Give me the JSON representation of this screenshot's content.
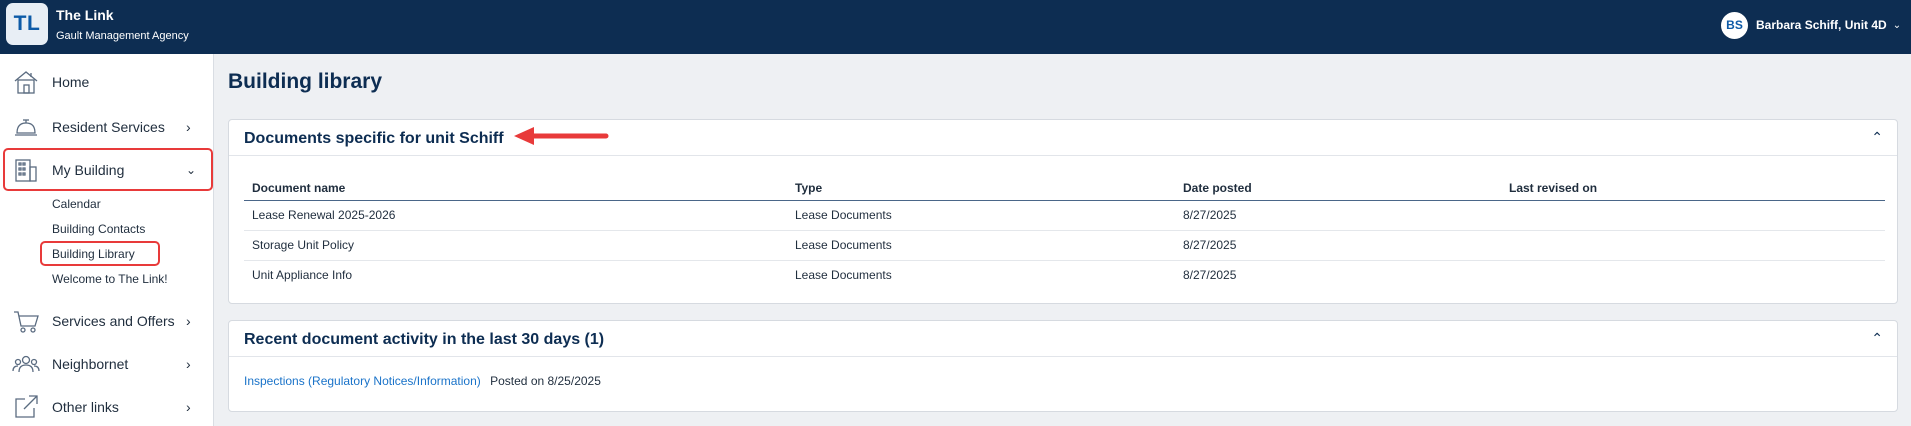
{
  "header": {
    "logo_text": "TL",
    "app_name": "The Link",
    "agency": "Gault Management Agency",
    "user_initials": "BS",
    "user_name": "Barbara Schiff, Unit 4D"
  },
  "sidebar": {
    "items": [
      {
        "label": "Home",
        "icon": "house-icon"
      },
      {
        "label": "Resident Services",
        "icon": "service-bell-icon"
      },
      {
        "label": "My Building",
        "icon": "building-icon"
      },
      {
        "label": "Services and Offers",
        "icon": "shopping-cart-icon"
      },
      {
        "label": "Neighbornet",
        "icon": "people-icon"
      },
      {
        "label": "Other links",
        "icon": "external-link-icon"
      }
    ],
    "sub_items": [
      "Calendar",
      "Building Contacts",
      "Building Library",
      "Welcome to The Link!"
    ]
  },
  "main": {
    "page_title": "Building library",
    "documents_card": {
      "title": "Documents specific for unit Schiff",
      "columns": [
        "Document name",
        "Type",
        "Date posted",
        "Last revised on"
      ],
      "rows": [
        {
          "name": "Lease Renewal 2025-2026",
          "type": "Lease Documents",
          "posted": "8/27/2025",
          "revised": ""
        },
        {
          "name": "Storage Unit Policy",
          "type": "Lease Documents",
          "posted": "8/27/2025",
          "revised": ""
        },
        {
          "name": "Unit Appliance Info",
          "type": "Lease Documents",
          "posted": "8/27/2025",
          "revised": ""
        }
      ]
    },
    "activity_card": {
      "title": "Recent document activity in the last 30 days (1)",
      "link_text": "Inspections (Regulatory Notices/Information)",
      "posted_text": "Posted on 8/25/2025"
    }
  },
  "colors": {
    "header_bg": "#0d2d52",
    "accent": "#1a73c9",
    "highlight": "#e83a3a"
  }
}
